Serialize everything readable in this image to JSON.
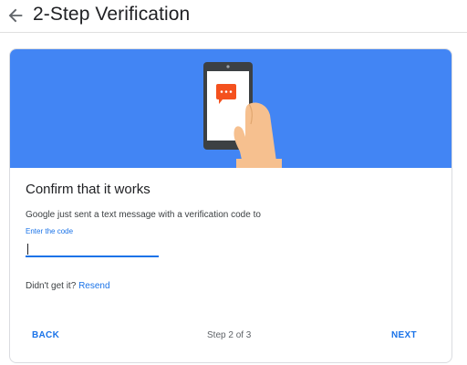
{
  "header": {
    "back_icon": "arrow-left-icon",
    "title": "2-Step Verification"
  },
  "card": {
    "illustration": "phone-with-message-icon",
    "heading": "Confirm that it works",
    "message": "Google just sent a text message with a verification code to",
    "code_field": {
      "label": "Enter the code",
      "value": ""
    },
    "resend": {
      "prompt": "Didn't get it?",
      "link": "Resend"
    },
    "footer": {
      "back_label": "BACK",
      "step_text": "Step 2 of 3",
      "next_label": "NEXT"
    }
  },
  "colors": {
    "accent": "#1a73e8",
    "hero_background": "#4285f4",
    "message_bubble": "#f4511e"
  }
}
